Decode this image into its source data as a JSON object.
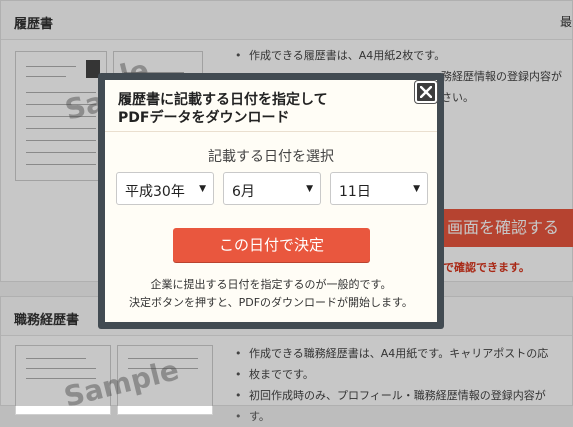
{
  "background": {
    "section1": {
      "title": "履歴書",
      "right_text": "最",
      "sample_label": "Sample",
      "sample_partial": "le",
      "bullets": [
        "作成できる履歴書は、A4用紙2枚です。",
        "務経歴情報の登録内容が",
        "さい。"
      ],
      "confirm_button": "画面を確認する",
      "confirm_note": "ータで確認できます。"
    },
    "section2": {
      "title": "職務経歴書",
      "sample_label": "Sample",
      "bullets": [
        "作成できる職務経歴書は、A4用紙です。キャリアポストの応",
        "枚までです。",
        "初回作成時のみ、プロフィール・職務経歴情報の登録内容が",
        "す。"
      ]
    }
  },
  "modal": {
    "title_line1": "履歴書に記載する日付を指定して",
    "title_line2": "PDFデータをダウンロード",
    "select_label": "記載する日付を選択",
    "selects": {
      "year": "平成30年",
      "month": "6月",
      "day": "11日"
    },
    "decide_button": "この日付で決定",
    "note_line1": "企業に提出する日付を指定するのが一般的です。",
    "note_line2": "決定ボタンを押すと、PDFのダウンロードが開始します。",
    "colors": {
      "accent": "#e9573e",
      "frame": "#424b52",
      "panel": "#fffdf6"
    }
  }
}
